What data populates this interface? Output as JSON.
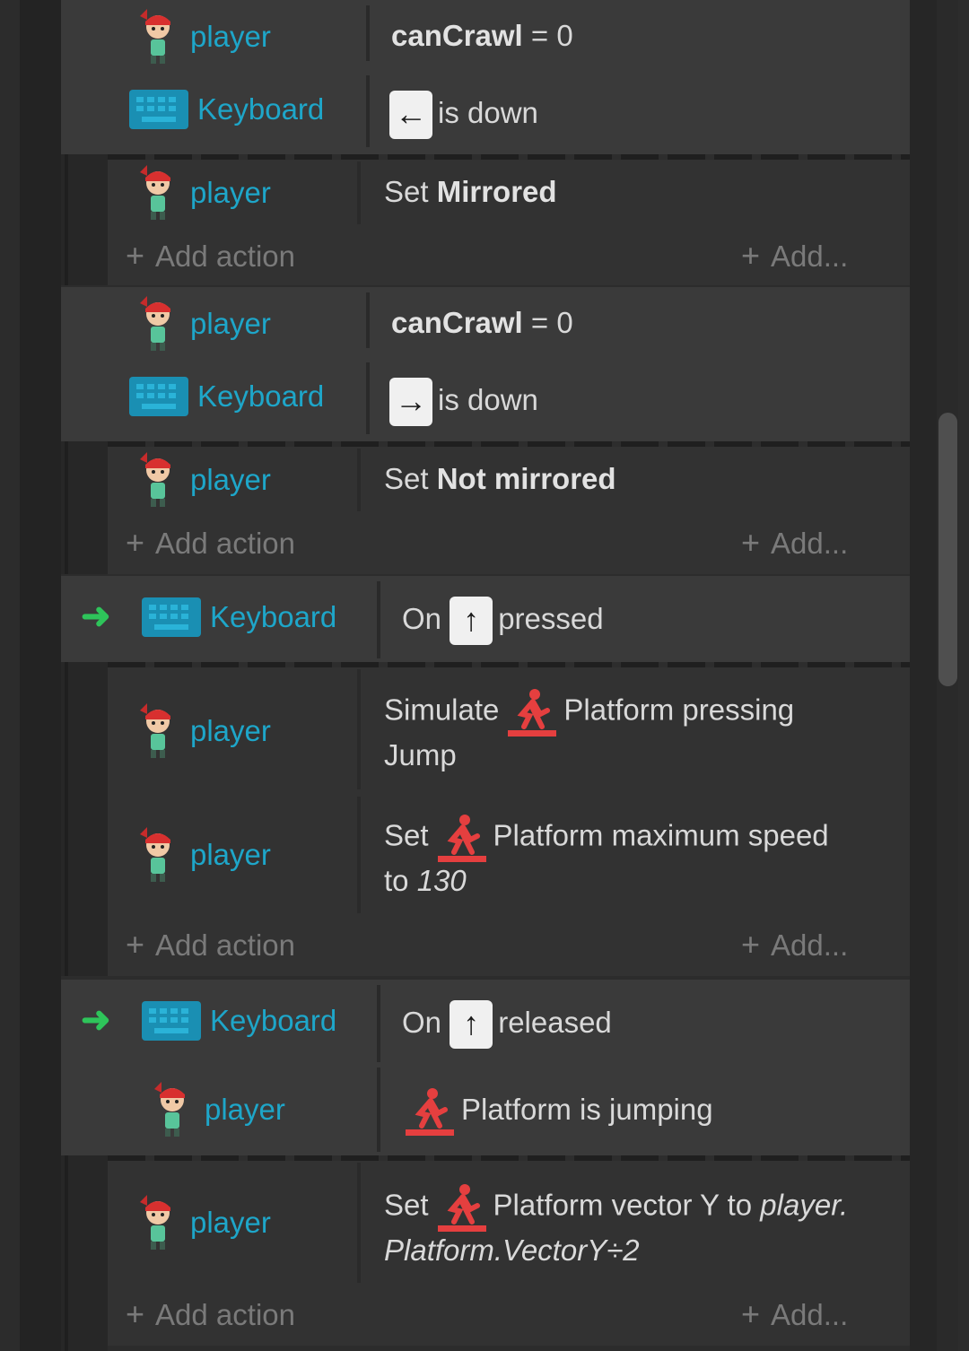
{
  "objects": {
    "player": "player",
    "keyboard": "Keyboard"
  },
  "labels": {
    "add_action": "Add action",
    "add_more": "Add...",
    "is_down": "is down",
    "on": "On",
    "pressed": "pressed",
    "released": "released",
    "set": "Set",
    "simulate": "Simulate"
  },
  "events": [
    {
      "conditions": [
        {
          "var": "canCrawl",
          "eq": " = 0"
        },
        {
          "key_glyph": "←"
        }
      ],
      "actions": [
        {
          "set_prefix": "Set ",
          "value": "Mirrored"
        }
      ]
    },
    {
      "conditions": [
        {
          "var": "canCrawl",
          "eq": " = 0"
        },
        {
          "key_glyph": "→"
        }
      ],
      "actions": [
        {
          "set_prefix": "Set ",
          "value": "Not mirrored"
        }
      ]
    },
    {
      "conditions": [
        {
          "key_glyph": "↑"
        }
      ],
      "actions": [
        {
          "text": "Platform pressing",
          "line2": "Jump"
        },
        {
          "text": "Platform maximum speed",
          "line2_prefix": "to ",
          "line2_value": "130"
        }
      ]
    },
    {
      "conditions": [
        {
          "key_glyph": "↑"
        },
        {
          "text": "Platform is jumping"
        }
      ],
      "actions": [
        {
          "text": "Platform vector Y to ",
          "expr_a": "player.",
          "line2": "Platform.VectorY÷2"
        }
      ]
    }
  ],
  "colors": {
    "object_name": "#1ea6c9",
    "behavior_icon": "#e53f3f",
    "trigger_arrow": "#2ec45a"
  }
}
